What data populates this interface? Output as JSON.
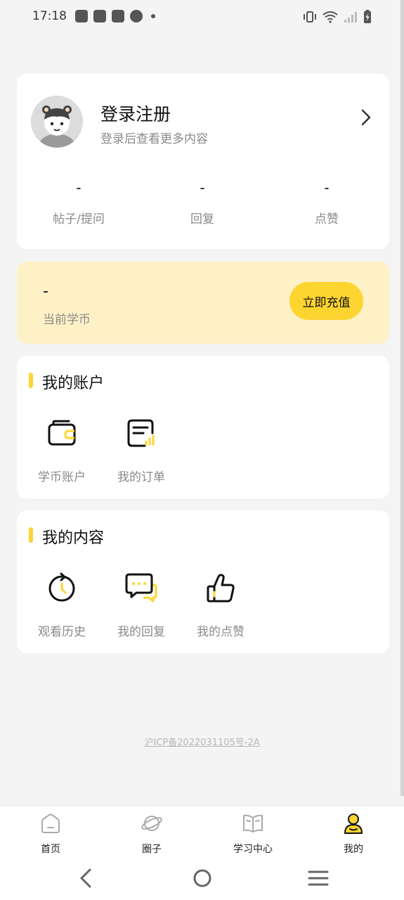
{
  "status_bar": {
    "time": "17:18",
    "notification_icons": [
      "shopping-bag-icon",
      "shopping-bag-icon",
      "shopping-bag-icon",
      "speedometer-icon"
    ],
    "right_icons": [
      "vibrate-icon",
      "wifi-icon",
      "signal-icon",
      "battery-charging-icon"
    ]
  },
  "profile": {
    "title": "登录注册",
    "subtitle": "登录后查看更多内容",
    "stats": [
      {
        "value": "-",
        "label": "帖子/提问"
      },
      {
        "value": "-",
        "label": "回复"
      },
      {
        "value": "-",
        "label": "点赞"
      }
    ]
  },
  "coin": {
    "value": "-",
    "label": "当前学币",
    "button": "立即充值",
    "background": "#fef1c6",
    "button_color": "#fdd430"
  },
  "account_section": {
    "title": "我的账户",
    "items": [
      {
        "label": "学币账户",
        "icon": "wallet-icon"
      },
      {
        "label": "我的订单",
        "icon": "order-list-icon"
      }
    ]
  },
  "content_section": {
    "title": "我的内容",
    "items": [
      {
        "label": "观看历史",
        "icon": "history-clock-icon"
      },
      {
        "label": "我的回复",
        "icon": "chat-bubble-icon"
      },
      {
        "label": "我的点赞",
        "icon": "thumbs-up-icon"
      }
    ]
  },
  "footer": {
    "icp": "沪ICP备2022031105号-2A"
  },
  "tabbar": {
    "active_index": 3,
    "tabs": [
      {
        "label": "首页",
        "icon": "home-icon"
      },
      {
        "label": "圈子",
        "icon": "planet-icon"
      },
      {
        "label": "学习中心",
        "icon": "book-icon"
      },
      {
        "label": "我的",
        "icon": "profile-icon"
      }
    ]
  },
  "nav_bar": {
    "buttons": [
      "back-icon",
      "home-circle-icon",
      "menu-icon"
    ]
  },
  "colors": {
    "accent": "#fdd430",
    "background": "#f4f4f4",
    "text_secondary": "#8a8a8a"
  }
}
